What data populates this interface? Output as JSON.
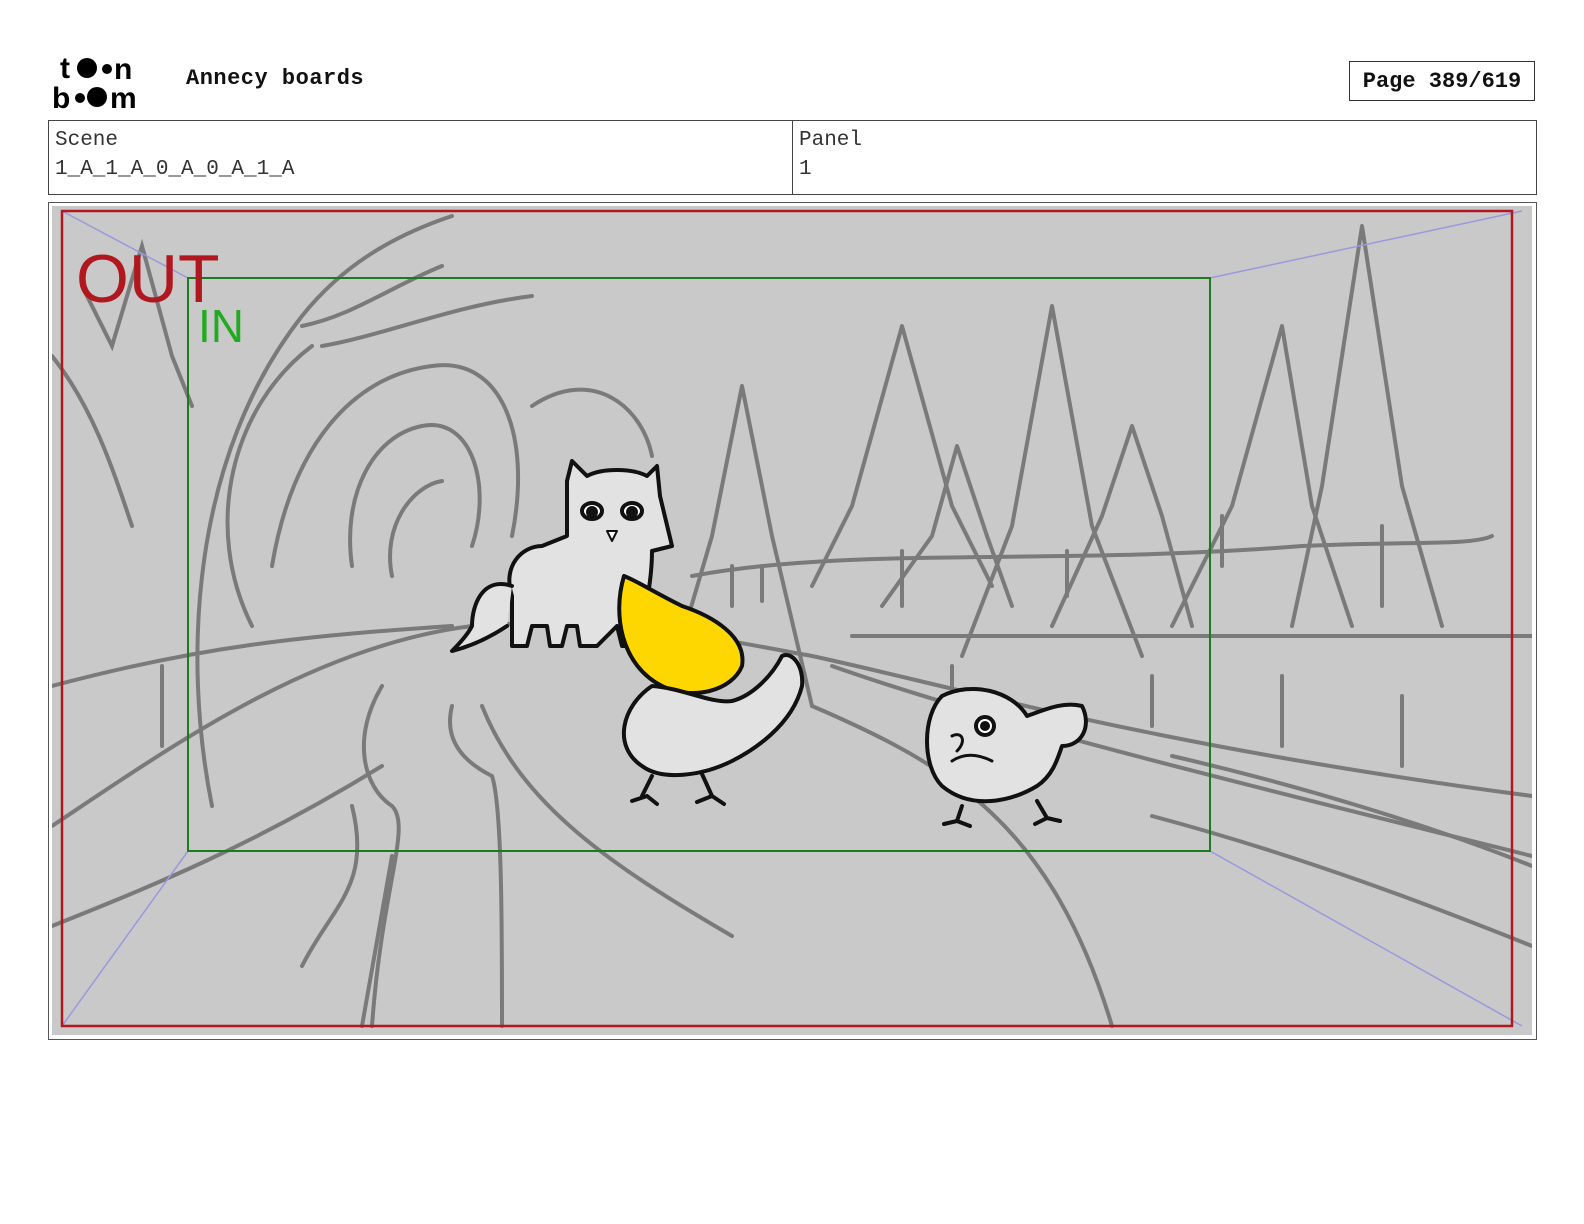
{
  "header": {
    "logo_text": "toon boom",
    "project_title": "Annecy boards",
    "page_indicator": "Page 389/619"
  },
  "info": {
    "scene_label": "Scene",
    "scene_value": "1_A_1_A_0_A_0_A_1_A",
    "panel_label": "Panel",
    "panel_value": "1"
  },
  "panel": {
    "out_label": "OUT",
    "in_label": "IN",
    "colors": {
      "out_frame": "#b0171f",
      "in_frame": "#1e7a1e",
      "background": "#c9c9c9",
      "sketch": "#7a7a7a",
      "highlight": "#ffd700",
      "guide": "#9999dd"
    }
  }
}
